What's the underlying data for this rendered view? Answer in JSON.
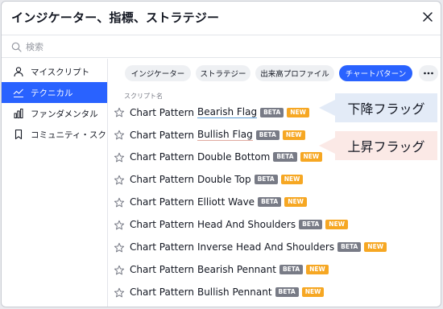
{
  "dialog": {
    "title": "インジケーター、指標、ストラテジー"
  },
  "search": {
    "placeholder": "検索",
    "value": ""
  },
  "sidebar": {
    "items": [
      {
        "label": "マイスクリプト",
        "icon": "user-icon",
        "active": false
      },
      {
        "label": "テクニカル",
        "icon": "chart-line-icon",
        "active": true
      },
      {
        "label": "ファンダメンタル",
        "icon": "bar-chart-icon",
        "active": false
      },
      {
        "label": "コミュニティ・スク…",
        "icon": "bookmark-icon",
        "active": false
      }
    ]
  },
  "tabs": [
    {
      "label": "インジケーター",
      "active": false
    },
    {
      "label": "ストラテジー",
      "active": false
    },
    {
      "label": "出来高プロファイル",
      "active": false
    },
    {
      "label": "チャートパターン",
      "active": true
    }
  ],
  "list": {
    "header": "スクリプト名",
    "rows": [
      {
        "prefix": "Chart Pattern",
        "name": "Bearish Flag",
        "beta": "BETA",
        "new": "NEW"
      },
      {
        "prefix": "Chart Pattern",
        "name": "Bullish Flag",
        "beta": "BETA",
        "new": "NEW"
      },
      {
        "prefix": "Chart Pattern",
        "name": "Double Bottom",
        "beta": "BETA",
        "new": "NEW"
      },
      {
        "prefix": "Chart Pattern",
        "name": "Double Top",
        "beta": "BETA",
        "new": "NEW"
      },
      {
        "prefix": "Chart Pattern",
        "name": "Elliott Wave",
        "beta": "BETA",
        "new": "NEW"
      },
      {
        "prefix": "Chart Pattern",
        "name": "Head And Shoulders",
        "beta": "BETA",
        "new": "NEW"
      },
      {
        "prefix": "Chart Pattern",
        "name": "Inverse Head And Shoulders",
        "beta": "BETA",
        "new": "NEW"
      },
      {
        "prefix": "Chart Pattern",
        "name": "Bearish Pennant",
        "beta": "BETA",
        "new": "NEW"
      },
      {
        "prefix": "Chart Pattern",
        "name": "Bullish Pennant",
        "beta": "BETA",
        "new": "NEW"
      }
    ]
  },
  "callouts": {
    "bearish": "下降フラッグ",
    "bullish": "上昇フラッグ"
  },
  "colors": {
    "accent": "#2962ff",
    "beta_badge": "#787b86",
    "new_badge": "#f6a723",
    "callout_blue_bg": "#e3ebf7",
    "callout_red_bg": "#fbe9e6"
  }
}
